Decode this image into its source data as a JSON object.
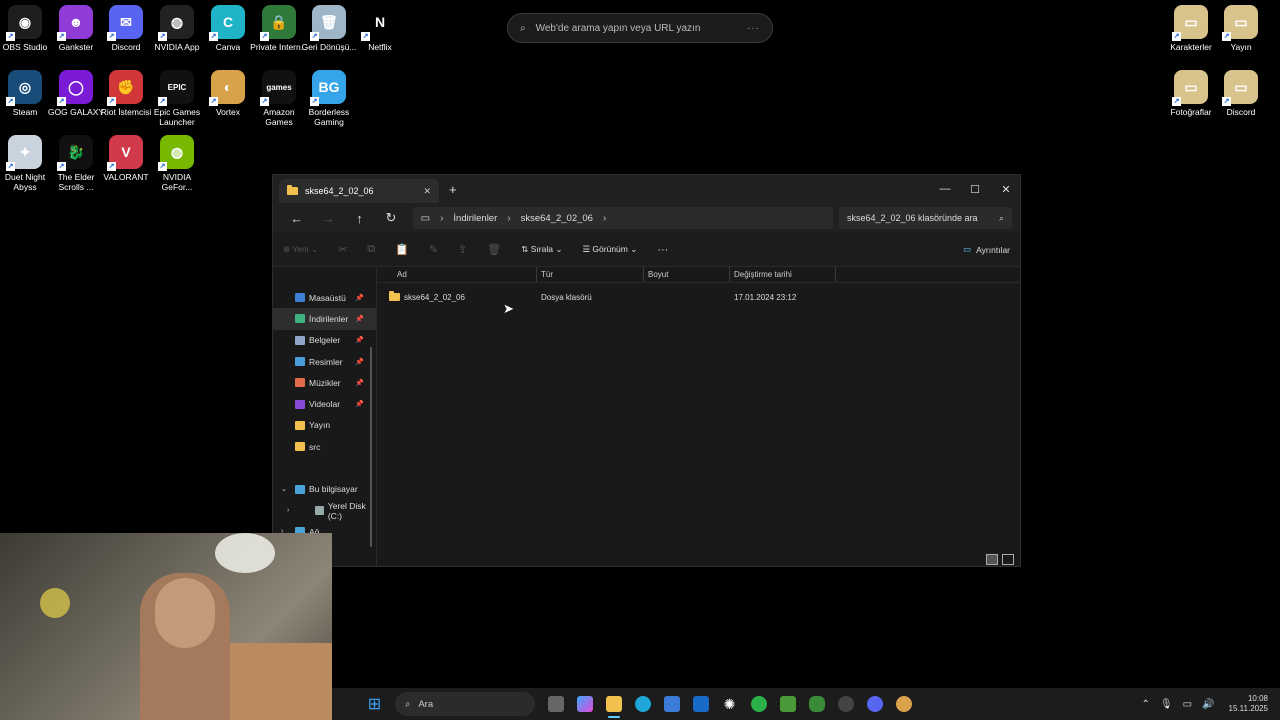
{
  "desktop_icons": [
    {
      "label": "OBS Studio",
      "color": "#1e1e1e",
      "glyph": "◉"
    },
    {
      "label": "Gankster",
      "color": "#8f3bd6",
      "glyph": "☻"
    },
    {
      "label": "Discord",
      "color": "#5865f2",
      "glyph": "✉"
    },
    {
      "label": "NVIDIA App",
      "color": "#222",
      "glyph": "◍"
    },
    {
      "label": "Canva",
      "color": "#1fb3c8",
      "glyph": "C"
    },
    {
      "label": "Private Intern...",
      "color": "#2f7a3a",
      "glyph": "🔒"
    },
    {
      "label": "Geri Dönüşü...",
      "color": "#9fb6c9",
      "glyph": "🗑"
    },
    {
      "label": "Netflix",
      "color": "#000",
      "glyph": "N"
    },
    {
      "label": "Steam",
      "color": "#1a4c7a",
      "glyph": "◎"
    },
    {
      "label": "GOG GALAXY",
      "color": "#7b1bd6",
      "glyph": "◯"
    },
    {
      "label": "Riot İstemcisi",
      "color": "#d13639",
      "glyph": "✊"
    },
    {
      "label": "Epic Games Launcher",
      "color": "#111",
      "glyph": "EPIC"
    },
    {
      "label": "Vortex",
      "color": "#d8a24a",
      "glyph": "◐"
    },
    {
      "label": "Amazon Games",
      "color": "#111",
      "glyph": "games"
    },
    {
      "label": "Borderless Gaming",
      "color": "#36a4e8",
      "glyph": "BG"
    },
    {
      "label": "Duet Night Abyss",
      "color": "#c9d3de",
      "glyph": "✦"
    },
    {
      "label": "The Elder Scrolls ...",
      "color": "#111",
      "glyph": "🐉"
    },
    {
      "label": "VALORANT",
      "color": "#d13a48",
      "glyph": "V"
    },
    {
      "label": "NVIDIA GeFor...",
      "color": "#76b900",
      "glyph": "◍"
    },
    {
      "label": "Karakterler",
      "color": "#d8c38c",
      "glyph": "▭"
    },
    {
      "label": "Yayın",
      "color": "#d8c38c",
      "glyph": "▭"
    },
    {
      "label": "Fotoğraflar",
      "color": "#d8c38c",
      "glyph": "▭"
    },
    {
      "label": "Discord",
      "color": "#d8c38c",
      "glyph": "▭"
    }
  ],
  "web_search": {
    "placeholder": "Web'de arama yapın veya URL yazın",
    "menu": "···"
  },
  "explorer": {
    "tab_title": "skse64_2_02_06",
    "new_tab": "+",
    "controls": {
      "minimize": "—",
      "maximize": "☐",
      "close": "✕"
    },
    "nav": {
      "back": "←",
      "forward": "→",
      "up": "↑",
      "refresh": "↻"
    },
    "breadcrumb": [
      "İndirilenler",
      "skse64_2_02_06"
    ],
    "search_placeholder": "skse64_2_02_06 klasöründe ara",
    "toolbar": {
      "new": "Yeni",
      "sort": "Sırala",
      "view": "Görünüm",
      "more": "···",
      "details": "Ayrıntılar"
    },
    "sidebar": [
      {
        "label": "Masaüstü",
        "pinned": true,
        "color": "#3d7fd6"
      },
      {
        "label": "İndirilenler",
        "pinned": true,
        "color": "#3fb37f",
        "active": true
      },
      {
        "label": "Belgeler",
        "pinned": true,
        "color": "#8fa4c8"
      },
      {
        "label": "Resimler",
        "pinned": true,
        "color": "#4a9cd8"
      },
      {
        "label": "Müzikler",
        "pinned": true,
        "color": "#e06a4a"
      },
      {
        "label": "Videolar",
        "pinned": true,
        "color": "#8a4ad8"
      },
      {
        "label": "Yayın",
        "pinned": false,
        "color": "#f2c14e"
      },
      {
        "label": "src",
        "pinned": false,
        "color": "#f2c14e"
      },
      {
        "label": "",
        "pinned": false,
        "color": ""
      },
      {
        "label": "Bu bilgisayar",
        "pinned": false,
        "color": "#4aa3d8",
        "expander": "⌄"
      },
      {
        "label": "Yerel Disk (C:)",
        "pinned": false,
        "color": "#9aa",
        "expander": "›",
        "indent": true
      },
      {
        "label": "Ağ",
        "pinned": false,
        "color": "#4aa3d8",
        "expander": "›"
      }
    ],
    "columns": [
      "Ad",
      "Tür",
      "Boyut",
      "Değiştirme tarihi"
    ],
    "files": [
      {
        "name": "skse64_2_02_06",
        "type": "Dosya klasörü",
        "size": "",
        "modified": "17.01.2024 23:12"
      }
    ]
  },
  "taskbar": {
    "search_label": "Ara",
    "time": "10:08",
    "date": "15.11.2025"
  }
}
